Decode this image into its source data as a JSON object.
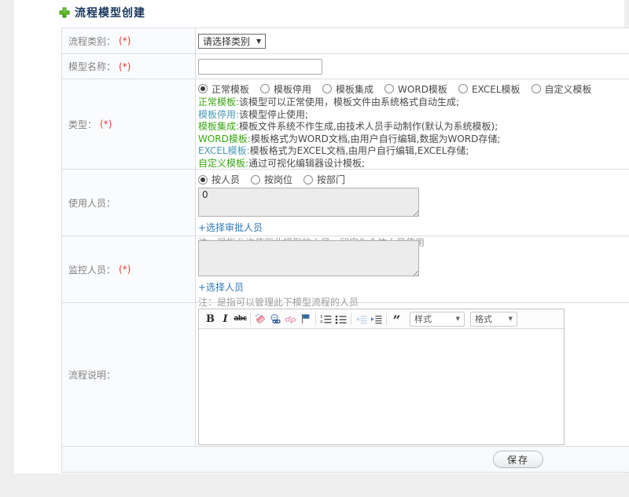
{
  "header": {
    "title": "流程模型创建"
  },
  "required_mark": "(*)",
  "carets": {
    "select": "▼",
    "dropdown": "▼"
  },
  "rows": {
    "category": {
      "label": "流程类别：",
      "select_value": "请选择类别"
    },
    "name": {
      "label": "模型名称：",
      "input_value": ""
    },
    "type": {
      "label": "类型：",
      "options": [
        {
          "label": "正常模板",
          "selected": true
        },
        {
          "label": "模板停用",
          "selected": false
        },
        {
          "label": "模板集成",
          "selected": false
        },
        {
          "label": "WORD模板",
          "selected": false
        },
        {
          "label": "EXCEL模板",
          "selected": false
        },
        {
          "label": "自定义模板",
          "selected": false
        }
      ],
      "descriptions": [
        {
          "term": "正常模板:",
          "text": "该模型可以正常使用，模板文件由系统格式自动生成;"
        },
        {
          "term": "模板停用:",
          "text": "该模型停止使用;"
        },
        {
          "term": "模板集成:",
          "text": "模板文件系统不作生成,由技术人员手动制作(默认为系统模板);"
        },
        {
          "term": "WORD模板:",
          "text": "模板格式为WORD文档,由用户自行编辑,数据为WORD存储;"
        },
        {
          "term": "EXCEL模板:",
          "text": "模板格式为EXCEL文档,由用户自行编辑,EXCEL存储;"
        },
        {
          "term": "自定义模板:",
          "text": "通过可视化编辑器设计模板;"
        }
      ]
    },
    "users": {
      "label": "使用人员：",
      "modes": [
        {
          "label": "按人员",
          "selected": true
        },
        {
          "label": "按岗位",
          "selected": false
        },
        {
          "label": "按部门",
          "selected": false
        }
      ],
      "textarea_value": "0",
      "select_link": "+选择审批人员",
      "note": "注：是指允许使用此模型的人员，留空为全体人员使用"
    },
    "monitors": {
      "label": "监控人员：",
      "textarea_value": "",
      "select_link": "+选择人员",
      "note": "注：是指可以管理此下模型流程的人员"
    },
    "description": {
      "label": "流程说明：",
      "editor": {
        "bold_glyph": "B",
        "italic_glyph": "I",
        "strike_glyph": "abc",
        "quote_glyph": "”",
        "style_dropdown": "样式",
        "format_dropdown": "格式",
        "icons": [
          "bold-icon",
          "italic-icon",
          "strikethrough-icon",
          "remove-format-icon",
          "link-icon",
          "unlink-icon",
          "anchor-flag-icon",
          "numbered-list-icon",
          "bulleted-list-icon",
          "outdent-icon",
          "indent-icon",
          "blockquote-icon"
        ]
      }
    }
  },
  "footer": {
    "save_label": "保存"
  },
  "colors": {
    "title": "#17365d",
    "required": "#e53935",
    "label_text": "#828282",
    "term_green": "#39a613",
    "term_blue": "#4a9ab4",
    "link": "#2e79bd",
    "note": "#9e9e9e",
    "plus_icon_green": "#57b327",
    "table_border": "#d9dde3"
  }
}
